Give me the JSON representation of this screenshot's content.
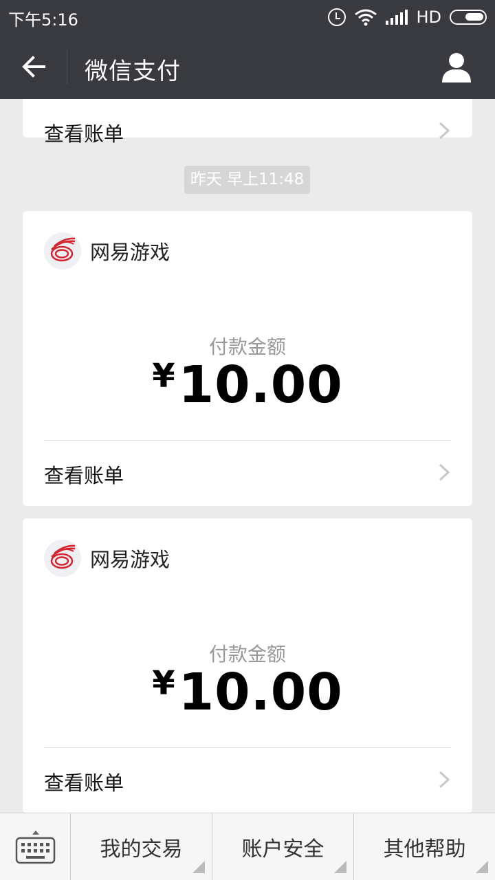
{
  "status_bar": {
    "time": "下午5:16",
    "network": "HD",
    "icons": [
      "alarm-icon",
      "wifi-icon",
      "signal-icon",
      "battery-icon"
    ]
  },
  "header": {
    "title": "微信支付",
    "back_icon": "arrow-left-icon",
    "profile_icon": "person-icon"
  },
  "messages": {
    "partial_card": {
      "link_label": "查看账单"
    },
    "timestamp": "昨天 早上11:48",
    "payments": [
      {
        "merchant": "网易游戏",
        "amount_label": "付款金额",
        "currency": "¥",
        "amount": "10.00",
        "link_label": "查看账单"
      },
      {
        "merchant": "网易游戏",
        "amount_label": "付款金额",
        "currency": "¥",
        "amount": "10.00",
        "link_label": "查看账单"
      }
    ]
  },
  "tabbar": {
    "keyboard_icon": "keyboard-icon",
    "tabs": [
      "我的交易",
      "账户安全",
      "其他帮助"
    ]
  },
  "colors": {
    "header_bg": "#393a3f",
    "page_bg": "#ebebeb",
    "logo_red": "#d6242f"
  }
}
